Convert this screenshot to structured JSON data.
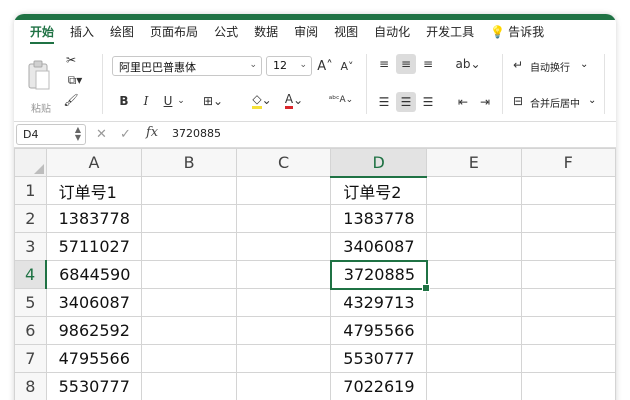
{
  "ribbon_tabs": [
    "开始",
    "插入",
    "绘图",
    "页面布局",
    "公式",
    "数据",
    "审阅",
    "视图",
    "自动化",
    "开发工具",
    "告诉我"
  ],
  "ribbon": {
    "paste_label": "粘贴",
    "font_name": "阿里巴巴普惠体",
    "font_size": "12",
    "wrap_text": "自动换行",
    "merge_center": "合并后居中",
    "bold": "B",
    "italic": "I",
    "underline": "U"
  },
  "formula_bar": {
    "name_box": "D4",
    "fx": "fx",
    "value": "3720885"
  },
  "sheet": {
    "columns": [
      "A",
      "B",
      "C",
      "D",
      "E",
      "F"
    ],
    "selected_column": "D",
    "selected_row": "4",
    "rows": [
      {
        "num": "1",
        "cells": [
          "订单号1",
          "",
          "",
          "订单号2",
          "",
          ""
        ]
      },
      {
        "num": "2",
        "cells": [
          "1383778",
          "",
          "",
          "1383778",
          "",
          ""
        ]
      },
      {
        "num": "3",
        "cells": [
          "5711027",
          "",
          "",
          "3406087",
          "",
          ""
        ]
      },
      {
        "num": "4",
        "cells": [
          "6844590",
          "",
          "",
          "3720885",
          "",
          ""
        ]
      },
      {
        "num": "5",
        "cells": [
          "3406087",
          "",
          "",
          "4329713",
          "",
          ""
        ]
      },
      {
        "num": "6",
        "cells": [
          "9862592",
          "",
          "",
          "4795566",
          "",
          ""
        ]
      },
      {
        "num": "7",
        "cells": [
          "4795566",
          "",
          "",
          "5530777",
          "",
          ""
        ]
      },
      {
        "num": "8",
        "cells": [
          "5530777",
          "",
          "",
          "7022619",
          "",
          ""
        ]
      }
    ]
  },
  "colors": {
    "accent": "#1f7244"
  }
}
